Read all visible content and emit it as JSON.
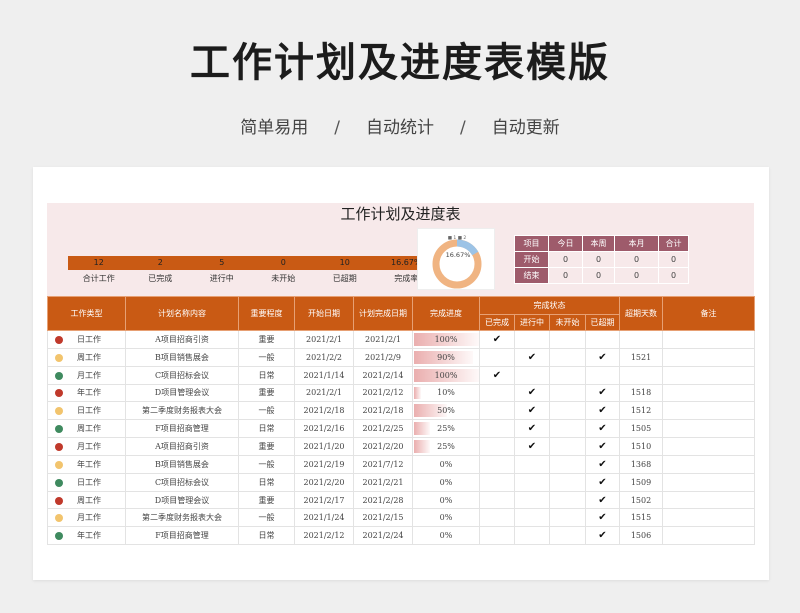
{
  "banner": {
    "title": "工作计划及进度表模版",
    "tags": [
      "简单易用",
      "自动统计",
      "自动更新"
    ],
    "separator": "/"
  },
  "sheet_title": "工作计划及进度表",
  "stats": [
    {
      "value": "12",
      "label": "合计工作"
    },
    {
      "value": "2",
      "label": "已完成"
    },
    {
      "value": "5",
      "label": "进行中"
    },
    {
      "value": "0",
      "label": "未开始"
    },
    {
      "value": "10",
      "label": "已超期"
    },
    {
      "value": "16.67%",
      "label": "完成率"
    }
  ],
  "donut": {
    "text": "16.67%",
    "legend_text": "■ 1 ■ 2",
    "fraction": 0.1667,
    "colors": {
      "done": "#9cc3e6",
      "rest": "#f0b482"
    }
  },
  "summary": {
    "headers": [
      "项目",
      "今日",
      "本周",
      "本月",
      "合计"
    ],
    "rows": [
      [
        "开始",
        "0",
        "0",
        "0",
        "0"
      ],
      [
        "结束",
        "0",
        "0",
        "0",
        "0"
      ]
    ]
  },
  "table": {
    "headers": {
      "type": "工作类型",
      "name": "计划名称内容",
      "importance": "重要程度",
      "start": "开始日期",
      "end": "计划完成日期",
      "progress": "完成进度",
      "status_group": "完成状态",
      "done": "已完成",
      "doing": "进行中",
      "notstarted": "未开始",
      "overdue": "已超期",
      "overdue_days": "超期天数",
      "note": "备注"
    },
    "check_mark": "✔",
    "rows": [
      {
        "dot": "#c0392b",
        "type": "日工作",
        "name": "A项目招商引资",
        "imp": "重要",
        "imp_class": "imp-red",
        "start": "2021/2/1",
        "end": "2021/2/1",
        "progress": "100%",
        "pct": 1.0,
        "done": true,
        "doing": false,
        "notstarted": false,
        "overdue": false,
        "days": ""
      },
      {
        "dot": "#f2c46d",
        "type": "周工作",
        "name": "B项目销售展会",
        "imp": "一般",
        "imp_class": "imp-green",
        "start": "2021/2/2",
        "end": "2021/2/9",
        "progress": "90%",
        "pct": 0.9,
        "done": false,
        "doing": true,
        "notstarted": false,
        "overdue": true,
        "days": "1521"
      },
      {
        "dot": "#3f8a5f",
        "type": "月工作",
        "name": "C项目招标会议",
        "imp": "日常",
        "imp_class": "imp-plain",
        "start": "2021/1/14",
        "end": "2021/2/14",
        "progress": "100%",
        "pct": 1.0,
        "done": true,
        "doing": false,
        "notstarted": false,
        "overdue": false,
        "days": ""
      },
      {
        "dot": "#c0392b",
        "type": "年工作",
        "name": "D项目管理会议",
        "imp": "重要",
        "imp_class": "imp-red",
        "start": "2021/2/1",
        "end": "2021/2/12",
        "progress": "10%",
        "pct": 0.1,
        "done": false,
        "doing": true,
        "notstarted": false,
        "overdue": true,
        "days": "1518"
      },
      {
        "dot": "#f2c46d",
        "type": "日工作",
        "name": "第二季度财务报表大会",
        "imp": "一般",
        "imp_class": "imp-green",
        "start": "2021/2/18",
        "end": "2021/2/18",
        "progress": "50%",
        "pct": 0.5,
        "done": false,
        "doing": true,
        "notstarted": false,
        "overdue": true,
        "days": "1512"
      },
      {
        "dot": "#3f8a5f",
        "type": "周工作",
        "name": "F项目招商管理",
        "imp": "日常",
        "imp_class": "imp-plain",
        "start": "2021/2/16",
        "end": "2021/2/25",
        "progress": "25%",
        "pct": 0.25,
        "done": false,
        "doing": true,
        "notstarted": false,
        "overdue": true,
        "days": "1505"
      },
      {
        "dot": "#c0392b",
        "type": "月工作",
        "name": "A项目招商引资",
        "imp": "重要",
        "imp_class": "imp-red",
        "start": "2021/1/20",
        "end": "2021/2/20",
        "progress": "25%",
        "pct": 0.25,
        "done": false,
        "doing": true,
        "notstarted": false,
        "overdue": true,
        "days": "1510"
      },
      {
        "dot": "#f2c46d",
        "type": "年工作",
        "name": "B项目销售展会",
        "imp": "一般",
        "imp_class": "imp-green",
        "start": "2021/2/19",
        "end": "2021/7/12",
        "progress": "0%",
        "pct": 0,
        "done": false,
        "doing": false,
        "notstarted": false,
        "overdue": true,
        "days": "1368"
      },
      {
        "dot": "#3f8a5f",
        "type": "日工作",
        "name": "C项目招标会议",
        "imp": "日常",
        "imp_class": "imp-plain",
        "start": "2021/2/20",
        "end": "2021/2/21",
        "progress": "0%",
        "pct": 0,
        "done": false,
        "doing": false,
        "notstarted": false,
        "overdue": true,
        "days": "1509"
      },
      {
        "dot": "#c0392b",
        "type": "周工作",
        "name": "D项目管理会议",
        "imp": "重要",
        "imp_class": "imp-red",
        "start": "2021/2/17",
        "end": "2021/2/28",
        "progress": "0%",
        "pct": 0,
        "done": false,
        "doing": false,
        "notstarted": false,
        "overdue": true,
        "days": "1502"
      },
      {
        "dot": "#f2c46d",
        "type": "月工作",
        "name": "第二季度财务报表大会",
        "imp": "一般",
        "imp_class": "imp-green",
        "start": "2021/1/24",
        "end": "2021/2/15",
        "progress": "0%",
        "pct": 0,
        "done": false,
        "doing": false,
        "notstarted": false,
        "overdue": true,
        "days": "1515"
      },
      {
        "dot": "#3f8a5f",
        "type": "年工作",
        "name": "F项目招商管理",
        "imp": "日常",
        "imp_class": "imp-plain",
        "start": "2021/2/12",
        "end": "2021/2/24",
        "progress": "0%",
        "pct": 0,
        "done": false,
        "doing": false,
        "notstarted": false,
        "overdue": true,
        "days": "1506"
      }
    ]
  }
}
